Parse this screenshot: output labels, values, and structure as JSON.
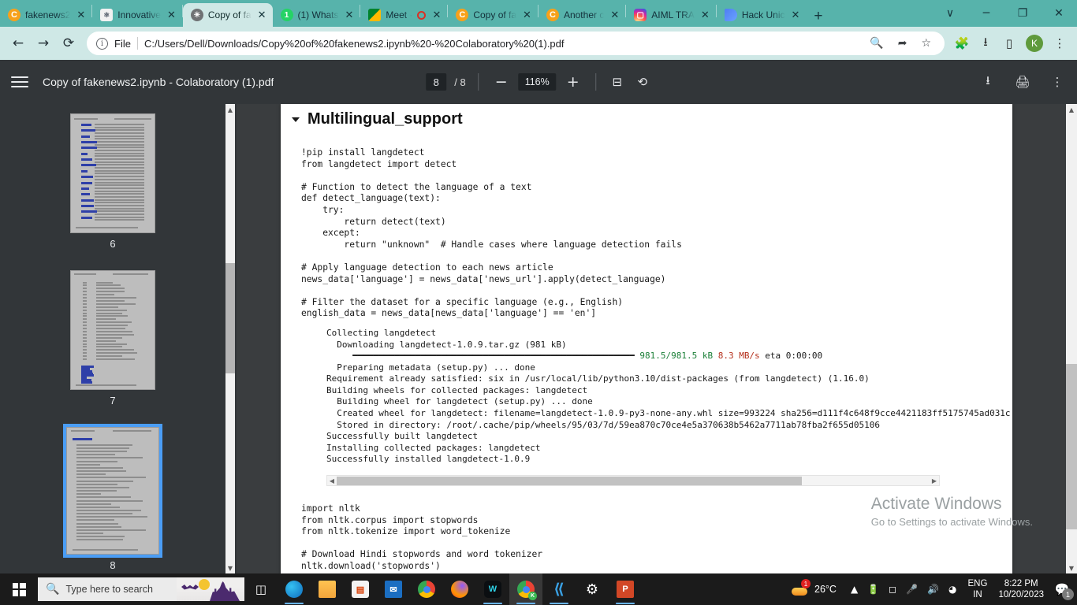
{
  "browser": {
    "tabs": [
      {
        "title": "fakenews2",
        "favicon": "coursera-icon",
        "active": false
      },
      {
        "title": "Innovative",
        "favicon": "chatgpt-icon",
        "active": false
      },
      {
        "title": "Copy of fa",
        "favicon": "pdf-icon",
        "active": true
      },
      {
        "title": "(1) Whats",
        "favicon": "whatsapp-icon",
        "active": false
      },
      {
        "title": "Meet ·",
        "favicon": "meet-icon",
        "active": false,
        "recording": true
      },
      {
        "title": "Copy of fa",
        "favicon": "coursera-icon",
        "active": false
      },
      {
        "title": "Another c",
        "favicon": "coursera-icon",
        "active": false
      },
      {
        "title": "AIML TRA",
        "favicon": "instagram-icon",
        "active": false
      },
      {
        "title": "Hack Unic",
        "favicon": "hack-icon",
        "active": false
      }
    ],
    "new_tab_label": "+",
    "window_controls": {
      "more": "∨",
      "minimize": "─",
      "maximize": "❐",
      "close": "✕"
    },
    "omnibox": {
      "scheme_label": "File",
      "url": "C:/Users/Dell/Downloads/Copy%20of%20fakenews2.ipynb%20-%20Colaboratory%20(1).pdf",
      "info_glyph": "ⓘ"
    },
    "profile_initial": "K"
  },
  "pdf_viewer": {
    "title": "Copy of fakenews2.ipynb - Colaboratory (1).pdf",
    "current_page": "8",
    "page_total": "/ 8",
    "zoom_level": "116%",
    "zoom_out_label": "−",
    "zoom_in_label": "+",
    "fit_label": "fit-page-icon",
    "rotate_label": "rotate-icon",
    "download_label": "download-icon",
    "print_label": "print-icon",
    "more_label": "more-options-icon"
  },
  "sidebar": {
    "thumbnails": [
      {
        "page": "6",
        "selected": false
      },
      {
        "page": "7",
        "selected": false
      },
      {
        "page": "8",
        "selected": true
      }
    ]
  },
  "document": {
    "section_title": "Multilingual_support",
    "code_cell_1": "!pip install langdetect\nfrom langdetect import detect\n\n# Function to detect the language of a text\ndef detect_language(text):\n    try:\n        return detect(text)\n    except:\n        return \"unknown\"  # Handle cases where language detection fails\n\n# Apply language detection to each news article\nnews_data['language'] = news_data['news_url'].apply(detect_language)\n\n# Filter the dataset for a specific language (e.g., English)\nenglish_data = news_data[news_data['language'] == 'en']",
    "output_lines": [
      {
        "text": "Collecting langdetect",
        "color": "default"
      },
      {
        "text": "  Downloading langdetect-1.0.9.tar.gz (981 kB)",
        "color": "default"
      },
      {
        "text": "     ━━━━━━━━━━━━━━━━━━━━━━━━━━━━━━━━━━━━━━━━ 981.5/981.5 kB 8.3 MB/s eta 0:00:00",
        "color": "progress"
      },
      {
        "text": "  Preparing metadata (setup.py) ... done",
        "color": "default"
      },
      {
        "text": "Requirement already satisfied: six in /usr/local/lib/python3.10/dist-packages (from langdetect) (1.16.0)",
        "color": "default"
      },
      {
        "text": "Building wheels for collected packages: langdetect",
        "color": "default"
      },
      {
        "text": "  Building wheel for langdetect (setup.py) ... done",
        "color": "default"
      },
      {
        "text": "  Created wheel for langdetect: filename=langdetect-1.0.9-py3-none-any.whl size=993224 sha256=d111f4c648f9cce4421183ff5175745ad031c",
        "color": "default"
      },
      {
        "text": "  Stored in directory: /root/.cache/pip/wheels/95/03/7d/59ea870c70ce4e5a370638b5462a7711ab78fba2f655d05106",
        "color": "default"
      },
      {
        "text": "Successfully built langdetect",
        "color": "default"
      },
      {
        "text": "Installing collected packages: langdetect",
        "color": "default"
      },
      {
        "text": "Successfully installed langdetect-1.0.9",
        "color": "default"
      }
    ],
    "progress_line": {
      "bar": "     ━━━━━━━━━━━━━━━━━━━━━━━━━━━━━━━━━━━━━━━━━━━━━━━━━━━━━━",
      "size": " 981.5/981.5 kB",
      "speed": " 8.3 MB/s",
      "eta": " eta 0:00:00"
    },
    "code_cell_2": "import nltk\nfrom nltk.corpus import stopwords\nfrom nltk.tokenize import word_tokenize\n\n# Download Hindi stopwords and word tokenizer\nnltk.download('stopwords')\nnltk.download('punkt')"
  },
  "watermark": {
    "line1": "Activate Windows",
    "line2": "Go to Settings to activate Windows."
  },
  "taskbar": {
    "search_placeholder": "Type here to search",
    "apps": [
      {
        "name": "task-view-icon"
      },
      {
        "name": "edge-icon"
      },
      {
        "name": "file-explorer-icon"
      },
      {
        "name": "microsoft-store-icon"
      },
      {
        "name": "mail-icon"
      },
      {
        "name": "chrome-icon"
      },
      {
        "name": "firefox-icon"
      },
      {
        "name": "whatsapp-desktop-icon"
      },
      {
        "name": "chrome-profile-icon"
      },
      {
        "name": "vscode-icon"
      },
      {
        "name": "settings-icon"
      },
      {
        "name": "powerpoint-icon"
      }
    ],
    "weather": {
      "temp": "26°C",
      "badge": "1"
    },
    "language": {
      "line1": "ENG",
      "line2": "IN"
    },
    "clock": {
      "time": "8:22 PM",
      "date": "10/20/2023"
    },
    "notification_count": "1"
  },
  "colors": {
    "tab_strip": "#57b3ab",
    "toolbar": "#cfe8e6",
    "pdf_toolbar": "#323639",
    "viewer_bg": "#3a3d3f",
    "selection": "#4a9df5",
    "taskbar": "#1b1b1b"
  }
}
